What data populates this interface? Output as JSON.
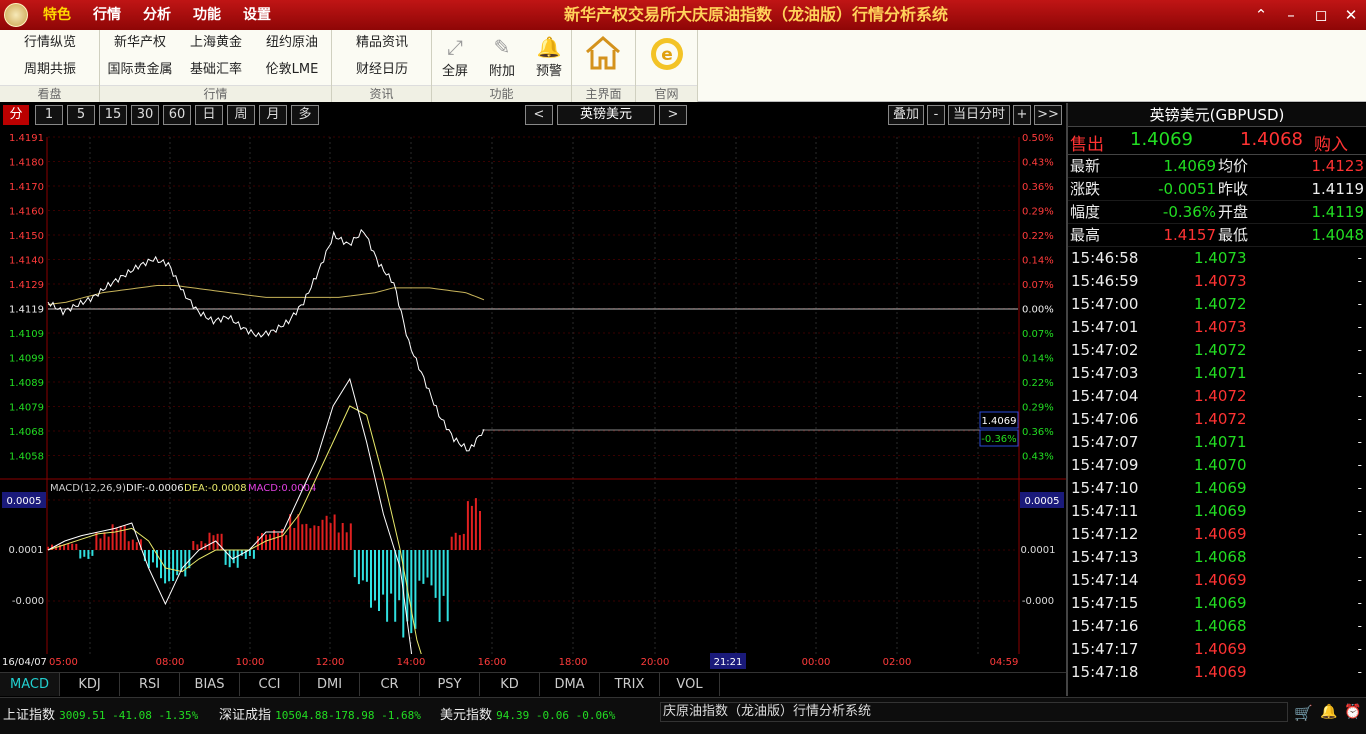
{
  "app": {
    "title": "新华产权交易所大庆原油指数（龙油版）行情分析系统",
    "menu": [
      "特色",
      "行情",
      "分析",
      "功能",
      "设置"
    ],
    "active_menu": 0
  },
  "window_buttons": [
    "⌃",
    "–",
    "◻",
    "✕"
  ],
  "ribbon": {
    "groups": [
      {
        "label": "看盘",
        "items": [
          "行情纵览",
          "周期共振"
        ]
      },
      {
        "label": "行情",
        "items": [
          "新华产权",
          "上海黄金",
          "纽约原油",
          "国际贵金属",
          "基础汇率",
          "伦敦LME"
        ]
      },
      {
        "label": "资讯",
        "items": [
          "精品资讯",
          "财经日历"
        ]
      },
      {
        "label": "功能",
        "items": [
          {
            "label": "全屏",
            "icon": "fullscreen-icon"
          },
          {
            "label": "附加",
            "icon": "attach-icon"
          },
          {
            "label": "预警",
            "icon": "bell-icon"
          }
        ]
      },
      {
        "label": "主界面",
        "icon": "home-icon"
      },
      {
        "label": "官网",
        "icon": "ie-icon"
      }
    ]
  },
  "toolbar": {
    "periods": [
      "分",
      "1",
      "5",
      "15",
      "30",
      "60",
      "日",
      "周",
      "月",
      "多"
    ],
    "active": 0,
    "prev": "<",
    "symbol": "英镑美元",
    "next": ">",
    "right": [
      "叠加",
      "-",
      "当日分时",
      "+",
      ">>"
    ]
  },
  "chart_data": {
    "type": "line",
    "price_axis": {
      "labels": [
        "1.4191",
        "1.4180",
        "1.4170",
        "1.4160",
        "1.4150",
        "1.4140",
        "1.4129",
        "1.4119",
        "1.4109",
        "1.4099",
        "1.4089",
        "1.4079",
        "1.4068",
        "1.4058"
      ],
      "prev_close": 1.4119
    },
    "pct_axis": {
      "labels": [
        "0.50%",
        "0.43%",
        "0.36%",
        "0.29%",
        "0.22%",
        "0.14%",
        "0.07%",
        "0.00%",
        "0.07%",
        "0.14%",
        "0.22%",
        "0.29%",
        "0.36%",
        "0.43%"
      ]
    },
    "current_price_label": "1.4069",
    "current_pct_label": "-0.36%",
    "price": [
      1.4122,
      1.4118,
      1.4121,
      1.4124,
      1.4129,
      1.4133,
      1.4137,
      1.414,
      1.4138,
      1.4126,
      1.4118,
      1.4114,
      1.4116,
      1.4111,
      1.4108,
      1.411,
      1.4114,
      1.4122,
      1.4135,
      1.415,
      1.4146,
      1.4152,
      1.4138,
      1.413,
      1.4105,
      1.409,
      1.4075,
      1.4065,
      1.406,
      1.4069
    ],
    "avg": [
      1.4121,
      1.4122,
      1.4124,
      1.4126,
      1.4127,
      1.4128,
      1.4129,
      1.4129,
      1.4128,
      1.4127,
      1.4126,
      1.4125,
      1.4124,
      1.4124,
      1.4124,
      1.4124,
      1.4124,
      1.4125,
      1.4126,
      1.4128,
      1.4128,
      1.4128,
      1.4127,
      1.4126,
      1.4123
    ],
    "macd": {
      "title": "MACD(12,26,9)",
      "dif_label": "DIF:-0.0006",
      "dea_label": "DEA:-0.0008",
      "macd_label": "MACD:0.0004",
      "axis": [
        "0.0005",
        "0.0001",
        "-0.000"
      ],
      "axis_right": [
        "0.0005",
        "0.0001",
        "-0.000"
      ],
      "dif": [
        0.0,
        5e-05,
        8e-05,
        0.0001,
        0.00012,
        0.00015,
        -0.0001,
        -0.0003,
        -0.0001,
        0.0,
        5e-05,
        -5e-05,
        0.0,
        0.0001,
        0.0001,
        0.0003,
        0.0005,
        0.0008,
        0.00095,
        0.0006,
        0.0002,
        -0.0001,
        -0.0008,
        -0.0009,
        -0.0011,
        -0.001,
        -0.0008
      ],
      "dea": [
        0.0,
        3e-05,
        6e-05,
        9e-05,
        0.0001,
        0.00012,
        5e-05,
        -0.0001,
        -0.00012,
        -5e-05,
        0.0,
        0.0,
        0.0,
        5e-05,
        8e-05,
        0.0002,
        0.0004,
        0.0006,
        0.0008,
        0.00075,
        0.0004,
        0.0,
        -0.0005,
        -0.0008,
        -0.001,
        -0.0011,
        -0.0009
      ],
      "hist": [
        3e-05,
        4e-05,
        -5e-05,
        0.0001,
        0.00015,
        6e-05,
        -0.0001,
        -0.0002,
        -0.00015,
        5e-05,
        0.0001,
        -0.0001,
        -5e-05,
        0.0001,
        0.00012,
        0.0002,
        0.00015,
        0.0002,
        0.00015,
        -0.0002,
        -0.00035,
        -0.0004,
        -0.0005,
        -0.0002,
        -0.0004,
        0.0001,
        0.0003
      ]
    },
    "time_labels": [
      "16/04/07 05:00",
      "08:00",
      "10:00",
      "12:00",
      "14:00",
      "16:00",
      "18:00",
      "20:00",
      "21:21",
      "00:00",
      "02:00",
      "04:59"
    ]
  },
  "indicator_tabs": [
    "MACD",
    "KDJ",
    "RSI",
    "BIAS",
    "CCI",
    "DMI",
    "CR",
    "PSY",
    "KD",
    "DMA",
    "TRIX",
    "VOL"
  ],
  "panel": {
    "title": "英镑美元(GBPUSD)",
    "sell_label": "售出",
    "sell": "1.4069",
    "buy": "1.4068",
    "buy_label": "购入",
    "rows": [
      {
        "l1": "最新",
        "v1": "1.4069",
        "c1": "green",
        "l2": "均价",
        "v2": "1.4123",
        "c2": "red"
      },
      {
        "l1": "涨跌",
        "v1": "-0.0051",
        "c1": "green",
        "l2": "昨收",
        "v2": "1.4119",
        "c2": "white"
      },
      {
        "l1": "幅度",
        "v1": "-0.36%",
        "c1": "green",
        "l2": "开盘",
        "v2": "1.4119",
        "c2": "green"
      },
      {
        "l1": "最高",
        "v1": "1.4157",
        "c1": "red",
        "l2": "最低",
        "v2": "1.4048",
        "c2": "green"
      }
    ],
    "ticks": [
      {
        "t": "15:46:58",
        "p": "1.4073",
        "c": "green"
      },
      {
        "t": "15:46:59",
        "p": "1.4073",
        "c": "red"
      },
      {
        "t": "15:47:00",
        "p": "1.4072",
        "c": "green"
      },
      {
        "t": "15:47:01",
        "p": "1.4073",
        "c": "red"
      },
      {
        "t": "15:47:02",
        "p": "1.4072",
        "c": "green"
      },
      {
        "t": "15:47:03",
        "p": "1.4071",
        "c": "green"
      },
      {
        "t": "15:47:04",
        "p": "1.4072",
        "c": "red"
      },
      {
        "t": "15:47:06",
        "p": "1.4072",
        "c": "red"
      },
      {
        "t": "15:47:07",
        "p": "1.4071",
        "c": "green"
      },
      {
        "t": "15:47:09",
        "p": "1.4070",
        "c": "green"
      },
      {
        "t": "15:47:10",
        "p": "1.4069",
        "c": "green"
      },
      {
        "t": "15:47:11",
        "p": "1.4069",
        "c": "green"
      },
      {
        "t": "15:47:12",
        "p": "1.4069",
        "c": "red"
      },
      {
        "t": "15:47:13",
        "p": "1.4068",
        "c": "green"
      },
      {
        "t": "15:47:14",
        "p": "1.4069",
        "c": "red"
      },
      {
        "t": "15:47:15",
        "p": "1.4069",
        "c": "green"
      },
      {
        "t": "15:47:16",
        "p": "1.4068",
        "c": "green"
      },
      {
        "t": "15:47:17",
        "p": "1.4069",
        "c": "red"
      },
      {
        "t": "15:47:18",
        "p": "1.4069",
        "c": "red"
      }
    ],
    "tick_suffix": "-"
  },
  "status": {
    "items": [
      {
        "name": "上证指数",
        "vals": "3009.51  -41.08  -1.35%"
      },
      {
        "name": "深证成指",
        "vals": "10504.88-178.98 -1.68%"
      },
      {
        "name": "美元指数",
        "vals": "94.39    -0.06  -0.06%"
      }
    ],
    "ticker": "庆原油指数（龙油版）行情分析系统",
    "icons": [
      "cart-icon",
      "bell-icon",
      "alarm-icon"
    ]
  }
}
